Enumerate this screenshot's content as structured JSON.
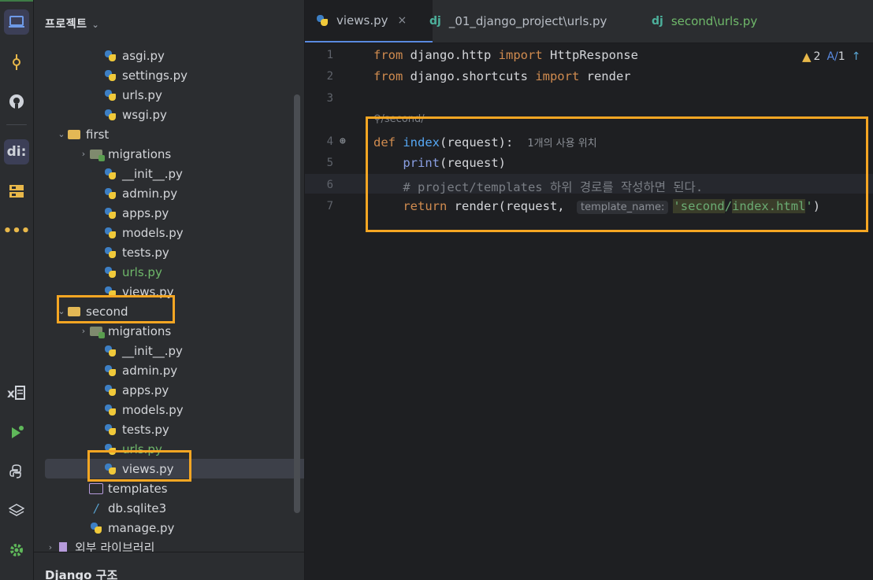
{
  "activity_bar": {
    "icons": [
      "project-icon",
      "commit-icon",
      "github-icon",
      "django-icon",
      "structure-icon",
      "more-icon",
      "excel-icon",
      "run-icon",
      "python-console-icon",
      "layers-icon",
      "settings-icon"
    ]
  },
  "project_panel": {
    "title": "프로젝트",
    "tree": [
      {
        "label": "asgi.py",
        "type": "py",
        "indent": 3
      },
      {
        "label": "settings.py",
        "type": "py",
        "indent": 3
      },
      {
        "label": "urls.py",
        "type": "py",
        "indent": 3
      },
      {
        "label": "wsgi.py",
        "type": "py",
        "indent": 3
      },
      {
        "label": "first",
        "type": "folder",
        "indent": 1,
        "expanded": true
      },
      {
        "label": "migrations",
        "type": "folder-db",
        "indent": 2,
        "expanded": false
      },
      {
        "label": "__init__.py",
        "type": "py",
        "indent": 3
      },
      {
        "label": "admin.py",
        "type": "py",
        "indent": 3
      },
      {
        "label": "apps.py",
        "type": "py",
        "indent": 3
      },
      {
        "label": "models.py",
        "type": "py",
        "indent": 3
      },
      {
        "label": "tests.py",
        "type": "py",
        "indent": 3
      },
      {
        "label": "urls.py",
        "type": "py",
        "indent": 3,
        "green": true
      },
      {
        "label": "views.py",
        "type": "py",
        "indent": 3
      },
      {
        "label": "second",
        "type": "folder",
        "indent": 1,
        "expanded": true
      },
      {
        "label": "migrations",
        "type": "folder-db",
        "indent": 2,
        "expanded": false
      },
      {
        "label": "__init__.py",
        "type": "py",
        "indent": 3
      },
      {
        "label": "admin.py",
        "type": "py",
        "indent": 3
      },
      {
        "label": "apps.py",
        "type": "py",
        "indent": 3
      },
      {
        "label": "models.py",
        "type": "py",
        "indent": 3
      },
      {
        "label": "tests.py",
        "type": "py",
        "indent": 3
      },
      {
        "label": "urls.py",
        "type": "py",
        "indent": 3,
        "green": true
      },
      {
        "label": "views.py",
        "type": "py",
        "indent": 3,
        "selected": true
      },
      {
        "label": "templates",
        "type": "folder-outline",
        "indent": 2
      },
      {
        "label": "db.sqlite3",
        "type": "db",
        "indent": 2
      },
      {
        "label": "manage.py",
        "type": "py",
        "indent": 2
      },
      {
        "label": "외부 라이브러리",
        "type": "lib",
        "indent": 0,
        "expanded": false
      }
    ],
    "structure_title": "Django 구조"
  },
  "tabs": [
    {
      "label": "views.py",
      "icon": "python-icon",
      "active": true,
      "close": "×"
    },
    {
      "label": "_01_django_project\\urls.py",
      "icon": "dj",
      "active": false
    },
    {
      "label": "second\\urls.py",
      "icon": "dj",
      "active": false,
      "green": true
    }
  ],
  "editor": {
    "inspections": {
      "warnings": "2",
      "typos": "1"
    },
    "line_numbers": [
      "1",
      "2",
      "3",
      "4",
      "5",
      "6",
      "7"
    ],
    "route_hint": "/second/",
    "usage_hint": "1개의 사용 위치",
    "param_hint": "template_name:"
  }
}
